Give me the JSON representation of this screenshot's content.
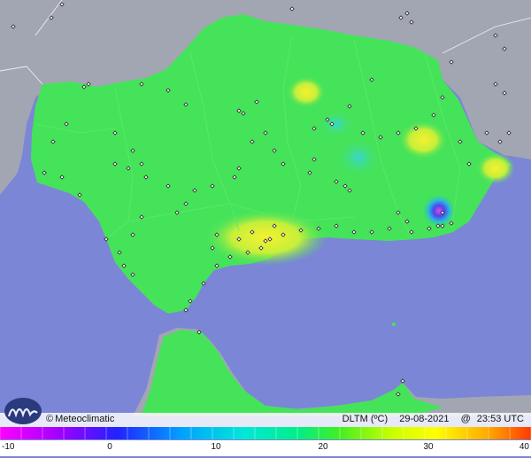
{
  "credit": {
    "symbol": "©",
    "brand": "Meteoclimatic"
  },
  "info": {
    "variable": "DLTM (ºC)",
    "date": "29-08-2021",
    "at": "@",
    "time": "23:53 UTC"
  },
  "colors": {
    "sea": "#7b86d6",
    "outside_land": "#9ea3b0",
    "region_base": "#45e35a",
    "warm": "#e8f23c",
    "cold_core": "#e24be0"
  },
  "scale": {
    "min": -10,
    "max": 40,
    "tick_labels": [
      "-10",
      "0",
      "10",
      "20",
      "30",
      "40"
    ],
    "tick_values": [
      -10,
      0,
      10,
      20,
      30,
      40
    ]
  },
  "icons": {
    "logo": "meteoclimatic-logo-icon",
    "station": "station-marker-icon"
  }
}
